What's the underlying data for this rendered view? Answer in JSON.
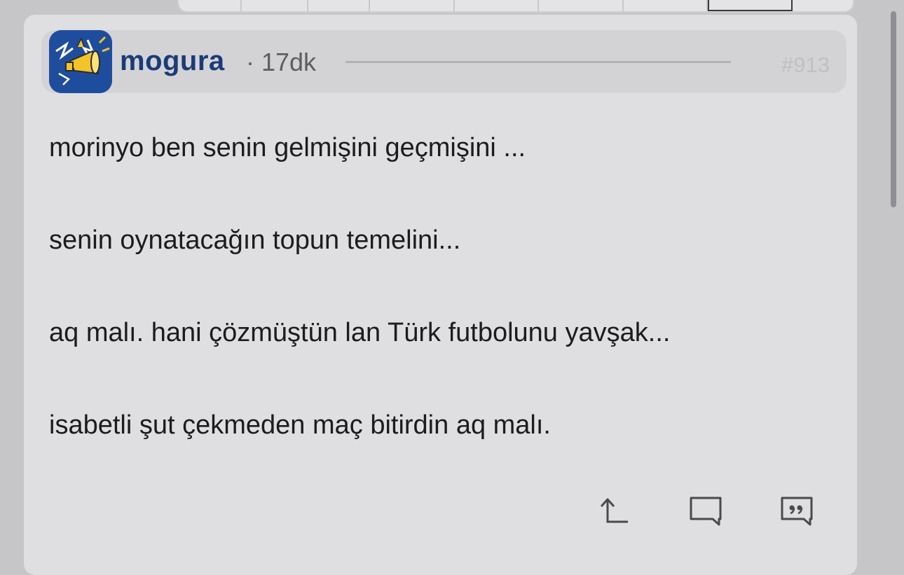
{
  "post": {
    "username": "mogura",
    "time": "· 17dk",
    "number": "#913",
    "lines": [
      "morinyo ben senin gelmişini geçmişini ...",
      "senin oynatacağın topun temelini...",
      "aq malı. hani çözmüştün lan Türk futbolunu yavşak...",
      "isabetli şut çekmeden maç bitirdin aq malı."
    ]
  },
  "icons": {
    "avatar": "megaphone-avatar",
    "share": "share-icon",
    "reply": "comment-icon",
    "quote": "quote-icon"
  },
  "colors": {
    "username": "#1b3b78",
    "avatar_bg": "#1f4d9e",
    "avatar_accent": "#f2c32b"
  }
}
